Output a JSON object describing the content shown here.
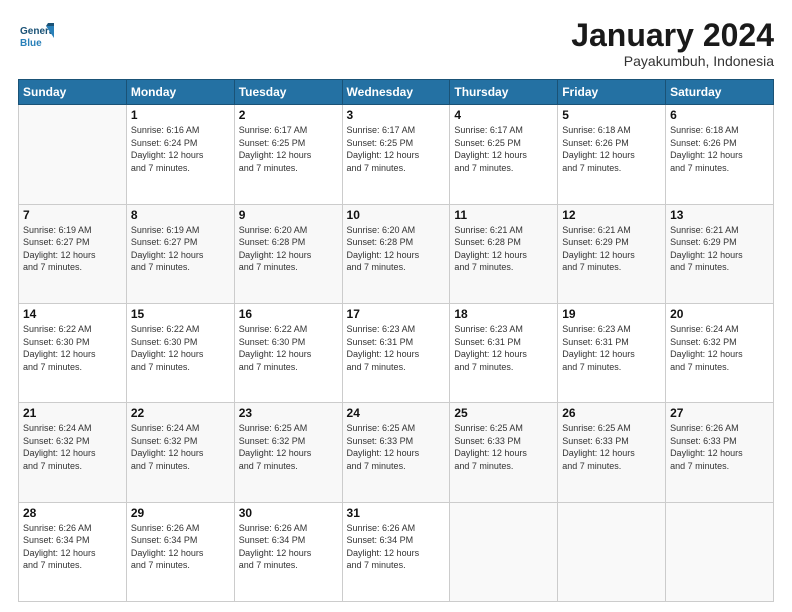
{
  "logo": {
    "line1": "General",
    "line2": "Blue"
  },
  "title": "January 2024",
  "location": "Payakumbuh, Indonesia",
  "days_header": [
    "Sunday",
    "Monday",
    "Tuesday",
    "Wednesday",
    "Thursday",
    "Friday",
    "Saturday"
  ],
  "weeks": [
    [
      {
        "day": "",
        "info": ""
      },
      {
        "day": "1",
        "info": "Sunrise: 6:16 AM\nSunset: 6:24 PM\nDaylight: 12 hours\nand 7 minutes."
      },
      {
        "day": "2",
        "info": "Sunrise: 6:17 AM\nSunset: 6:25 PM\nDaylight: 12 hours\nand 7 minutes."
      },
      {
        "day": "3",
        "info": "Sunrise: 6:17 AM\nSunset: 6:25 PM\nDaylight: 12 hours\nand 7 minutes."
      },
      {
        "day": "4",
        "info": "Sunrise: 6:17 AM\nSunset: 6:25 PM\nDaylight: 12 hours\nand 7 minutes."
      },
      {
        "day": "5",
        "info": "Sunrise: 6:18 AM\nSunset: 6:26 PM\nDaylight: 12 hours\nand 7 minutes."
      },
      {
        "day": "6",
        "info": "Sunrise: 6:18 AM\nSunset: 6:26 PM\nDaylight: 12 hours\nand 7 minutes."
      }
    ],
    [
      {
        "day": "7",
        "info": "Sunrise: 6:19 AM\nSunset: 6:27 PM\nDaylight: 12 hours\nand 7 minutes."
      },
      {
        "day": "8",
        "info": "Sunrise: 6:19 AM\nSunset: 6:27 PM\nDaylight: 12 hours\nand 7 minutes."
      },
      {
        "day": "9",
        "info": "Sunrise: 6:20 AM\nSunset: 6:28 PM\nDaylight: 12 hours\nand 7 minutes."
      },
      {
        "day": "10",
        "info": "Sunrise: 6:20 AM\nSunset: 6:28 PM\nDaylight: 12 hours\nand 7 minutes."
      },
      {
        "day": "11",
        "info": "Sunrise: 6:21 AM\nSunset: 6:28 PM\nDaylight: 12 hours\nand 7 minutes."
      },
      {
        "day": "12",
        "info": "Sunrise: 6:21 AM\nSunset: 6:29 PM\nDaylight: 12 hours\nand 7 minutes."
      },
      {
        "day": "13",
        "info": "Sunrise: 6:21 AM\nSunset: 6:29 PM\nDaylight: 12 hours\nand 7 minutes."
      }
    ],
    [
      {
        "day": "14",
        "info": "Sunrise: 6:22 AM\nSunset: 6:30 PM\nDaylight: 12 hours\nand 7 minutes."
      },
      {
        "day": "15",
        "info": "Sunrise: 6:22 AM\nSunset: 6:30 PM\nDaylight: 12 hours\nand 7 minutes."
      },
      {
        "day": "16",
        "info": "Sunrise: 6:22 AM\nSunset: 6:30 PM\nDaylight: 12 hours\nand 7 minutes."
      },
      {
        "day": "17",
        "info": "Sunrise: 6:23 AM\nSunset: 6:31 PM\nDaylight: 12 hours\nand 7 minutes."
      },
      {
        "day": "18",
        "info": "Sunrise: 6:23 AM\nSunset: 6:31 PM\nDaylight: 12 hours\nand 7 minutes."
      },
      {
        "day": "19",
        "info": "Sunrise: 6:23 AM\nSunset: 6:31 PM\nDaylight: 12 hours\nand 7 minutes."
      },
      {
        "day": "20",
        "info": "Sunrise: 6:24 AM\nSunset: 6:32 PM\nDaylight: 12 hours\nand 7 minutes."
      }
    ],
    [
      {
        "day": "21",
        "info": "Sunrise: 6:24 AM\nSunset: 6:32 PM\nDaylight: 12 hours\nand 7 minutes."
      },
      {
        "day": "22",
        "info": "Sunrise: 6:24 AM\nSunset: 6:32 PM\nDaylight: 12 hours\nand 7 minutes."
      },
      {
        "day": "23",
        "info": "Sunrise: 6:25 AM\nSunset: 6:32 PM\nDaylight: 12 hours\nand 7 minutes."
      },
      {
        "day": "24",
        "info": "Sunrise: 6:25 AM\nSunset: 6:33 PM\nDaylight: 12 hours\nand 7 minutes."
      },
      {
        "day": "25",
        "info": "Sunrise: 6:25 AM\nSunset: 6:33 PM\nDaylight: 12 hours\nand 7 minutes."
      },
      {
        "day": "26",
        "info": "Sunrise: 6:25 AM\nSunset: 6:33 PM\nDaylight: 12 hours\nand 7 minutes."
      },
      {
        "day": "27",
        "info": "Sunrise: 6:26 AM\nSunset: 6:33 PM\nDaylight: 12 hours\nand 7 minutes."
      }
    ],
    [
      {
        "day": "28",
        "info": "Sunrise: 6:26 AM\nSunset: 6:34 PM\nDaylight: 12 hours\nand 7 minutes."
      },
      {
        "day": "29",
        "info": "Sunrise: 6:26 AM\nSunset: 6:34 PM\nDaylight: 12 hours\nand 7 minutes."
      },
      {
        "day": "30",
        "info": "Sunrise: 6:26 AM\nSunset: 6:34 PM\nDaylight: 12 hours\nand 7 minutes."
      },
      {
        "day": "31",
        "info": "Sunrise: 6:26 AM\nSunset: 6:34 PM\nDaylight: 12 hours\nand 7 minutes."
      },
      {
        "day": "",
        "info": ""
      },
      {
        "day": "",
        "info": ""
      },
      {
        "day": "",
        "info": ""
      }
    ]
  ]
}
